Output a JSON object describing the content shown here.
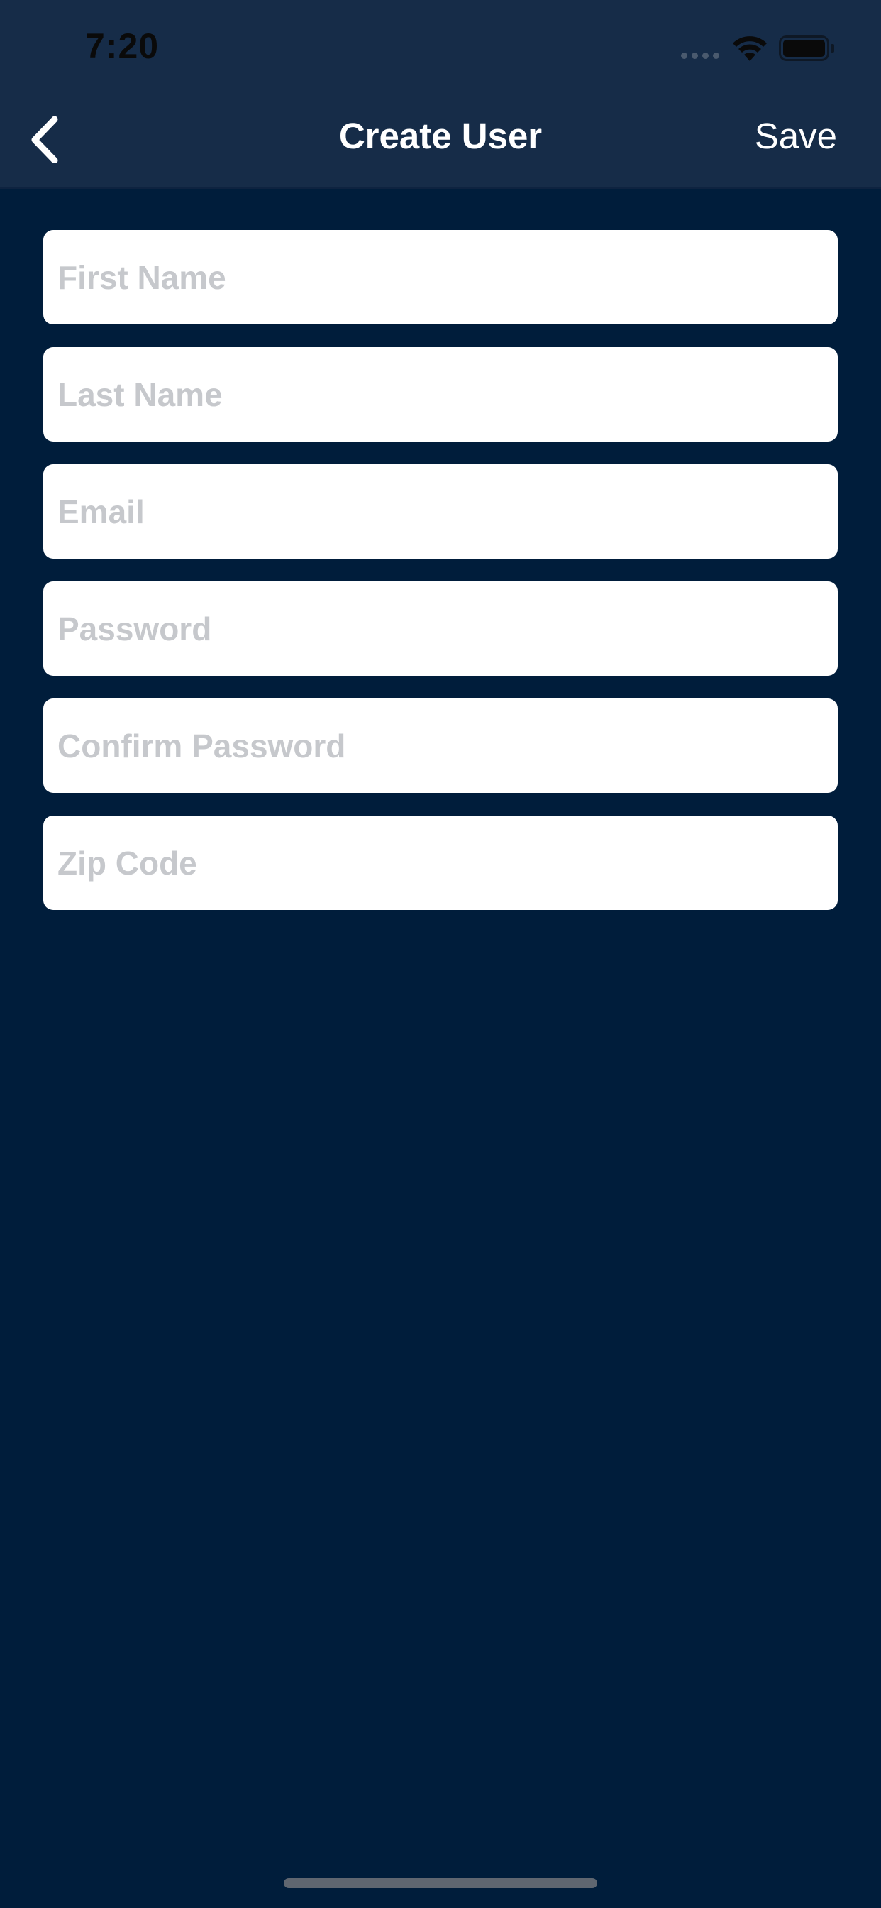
{
  "status_bar": {
    "time": "7:20",
    "wifi_icon": "wifi-icon",
    "battery_icon": "battery-icon"
  },
  "nav": {
    "back_icon": "chevron-left-icon",
    "title": "Create User",
    "save_label": "Save"
  },
  "form": {
    "fields": [
      {
        "placeholder": "First Name",
        "value": ""
      },
      {
        "placeholder": "Last Name",
        "value": ""
      },
      {
        "placeholder": "Email",
        "value": ""
      },
      {
        "placeholder": "Password",
        "value": ""
      },
      {
        "placeholder": "Confirm Password",
        "value": ""
      },
      {
        "placeholder": "Zip Code",
        "value": ""
      }
    ]
  },
  "colors": {
    "background": "#001d3b",
    "header": "#162c48",
    "field_bg": "#ffffff",
    "placeholder": "#c6c8cc",
    "text_light": "#ffffff"
  }
}
